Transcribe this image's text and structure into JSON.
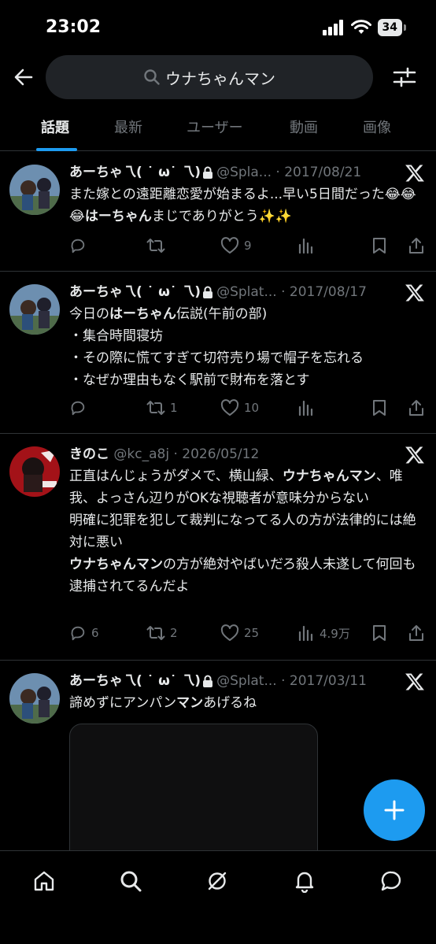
{
  "status_bar": {
    "time": "23:02",
    "battery": "34"
  },
  "header": {
    "search_query": "ウナちゃんマン"
  },
  "tabs": [
    {
      "label": "話題",
      "active": true
    },
    {
      "label": "最新",
      "active": false
    },
    {
      "label": "ユーザー",
      "active": false
    },
    {
      "label": "動画",
      "active": false
    },
    {
      "label": "画像",
      "active": false
    }
  ],
  "tweets": [
    {
      "name": "あーちゃ乁( ˙ ω˙ 乁)",
      "handle": "@Spla...",
      "date": "· 2017/08/21",
      "text_parts": [
        "また嫁との遠距離恋愛が始まるよ...早い5日間だった😂😂😂",
        "はーちゃん",
        "まじでありがとう✨✨"
      ],
      "replies": "",
      "retweets": "",
      "likes": "9",
      "views": ""
    },
    {
      "name": "あーちゃ乁( ˙ ω˙ 乁)",
      "handle": "@Splat...",
      "date": "· 2017/08/17",
      "text_parts": [
        "今日の",
        "はーちゃん",
        "伝説(午前の部)\n・集合時間寝坊\n・その際に慌てすぎて切符売り場で帽子を忘れる\n・なぜか理由もなく駅前で財布を落とす"
      ],
      "replies": "",
      "retweets": "1",
      "likes": "10",
      "views": ""
    },
    {
      "name": "きのこ",
      "handle": "@kc_a8j",
      "date": "· 2026/05/12",
      "text_parts": [
        "正直はんじょうがダメで、横山緑、",
        "ウナちゃんマン",
        "、唯我、よっさん辺りがOKな視聴者が意味分からない\n明確に犯罪を犯して裁判になってる人の方が法律的には絶対に悪い\n",
        "ウナちゃんマン",
        "の方が絶対やばいだろ殺人未遂して何回も逮捕されてるんだよ"
      ],
      "replies": "6",
      "retweets": "2",
      "likes": "25",
      "views": "4.9万"
    },
    {
      "name": "あーちゃ乁( ˙ ω˙ 乁)",
      "handle": "@Splat...",
      "date": "· 2017/03/11",
      "text_parts": [
        "諦めずにアンパン",
        "マン",
        "あげるね"
      ]
    }
  ],
  "icons": {
    "back": "arrow-left-icon",
    "search": "search-icon",
    "filter": "sliders-icon",
    "x": "x-logo-icon",
    "reply": "reply-icon",
    "retweet": "retweet-icon",
    "like": "heart-icon",
    "views": "views-icon",
    "bookmark": "bookmark-icon",
    "share": "share-icon",
    "compose": "plus-icon",
    "nav": [
      "home-icon",
      "search-icon",
      "grok-icon",
      "notifications-icon",
      "messages-icon"
    ]
  },
  "colors": {
    "accent": "#1d9bf0",
    "background": "#000000",
    "muted": "#71767b",
    "text": "#e7e9ea"
  }
}
